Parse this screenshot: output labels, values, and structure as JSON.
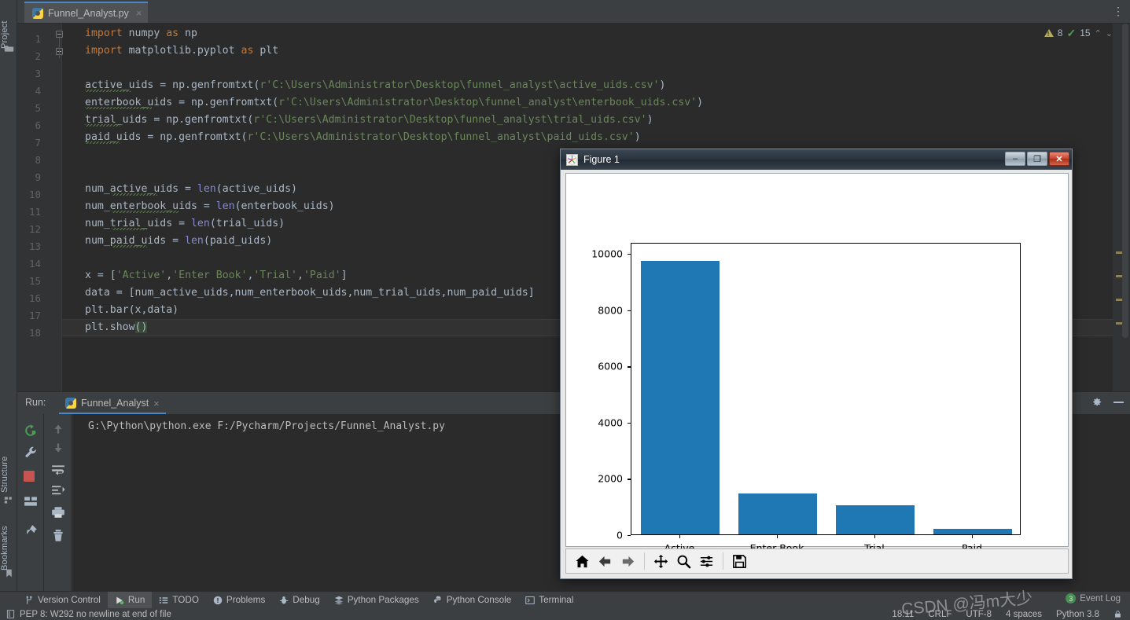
{
  "ide": {
    "left_strip": [
      {
        "label": "Project",
        "icon": "folder-icon"
      },
      {
        "label": "Structure",
        "icon": "structure-icon"
      },
      {
        "label": "Bookmarks",
        "icon": "bookmark-icon"
      }
    ],
    "tab": {
      "title": "Funnel_Analyst.py",
      "close": "×",
      "icon": "python-file-icon"
    },
    "kebab": "⋮",
    "inspections": {
      "warning_count": "8",
      "ok_count": "15",
      "up": "⌃",
      "down": "⌄"
    },
    "editor_lines": [
      {
        "n": "1",
        "text": "import numpy as np"
      },
      {
        "n": "2",
        "text": "import matplotlib.pyplot as plt"
      },
      {
        "n": "3",
        "text": ""
      },
      {
        "n": "4",
        "text": "active_uids = np.genfromtxt(r'C:\\Users\\Administrator\\Desktop\\funnel_analyst\\active_uids.csv')"
      },
      {
        "n": "5",
        "text": "enterbook_uids = np.genfromtxt(r'C:\\Users\\Administrator\\Desktop\\funnel_analyst\\enterbook_uids.csv')"
      },
      {
        "n": "6",
        "text": "trial_uids = np.genfromtxt(r'C:\\Users\\Administrator\\Desktop\\funnel_analyst\\trial_uids.csv')"
      },
      {
        "n": "7",
        "text": "paid_uids = np.genfromtxt(r'C:\\Users\\Administrator\\Desktop\\funnel_analyst\\paid_uids.csv')"
      },
      {
        "n": "8",
        "text": ""
      },
      {
        "n": "9",
        "text": ""
      },
      {
        "n": "10",
        "text": "num_active_uids = len(active_uids)"
      },
      {
        "n": "11",
        "text": "num_enterbook_uids = len(enterbook_uids)"
      },
      {
        "n": "12",
        "text": "num_trial_uids = len(trial_uids)"
      },
      {
        "n": "13",
        "text": "num_paid_uids = len(paid_uids)"
      },
      {
        "n": "14",
        "text": ""
      },
      {
        "n": "15",
        "text": "x = ['Active','Enter Book','Trial','Paid']"
      },
      {
        "n": "16",
        "text": "data = [num_active_uids,num_enterbook_uids,num_trial_uids,num_paid_uids]"
      },
      {
        "n": "17",
        "text": "plt.bar(x,data)"
      },
      {
        "n": "18",
        "text": "plt.show()"
      }
    ],
    "run": {
      "label": "Run:",
      "tab_title": "Funnel_Analyst",
      "tab_close": "×",
      "console_text": "G:\\Python\\python.exe F:/Pycharm/Projects/Funnel_Analyst.py",
      "header_icons": [
        "settings-gear-icon",
        "minimize-icon"
      ],
      "gutter_col1": [
        "rerun-icon",
        "wrench-icon",
        "stop-icon",
        "layout-icon",
        "pin-icon"
      ],
      "gutter_col2": [
        "up-arrow-icon",
        "down-arrow-icon",
        "soft-wrap-icon",
        "scroll-to-end-icon",
        "print-icon",
        "trash-icon"
      ]
    },
    "bottom_tabs": [
      {
        "label": "Version Control",
        "icon": "branch-icon",
        "active": false
      },
      {
        "label": "Run",
        "icon": "play-icon",
        "active": true
      },
      {
        "label": "TODO",
        "icon": "list-icon",
        "active": false
      },
      {
        "label": "Problems",
        "icon": "exclamation-icon",
        "active": false
      },
      {
        "label": "Debug",
        "icon": "bug-icon",
        "active": false
      },
      {
        "label": "Python Packages",
        "icon": "packages-icon",
        "active": false
      },
      {
        "label": "Python Console",
        "icon": "python-icon",
        "active": false
      },
      {
        "label": "Terminal",
        "icon": "terminal-icon",
        "active": false
      }
    ],
    "status_left": "PEP 8: W292 no newline at end of file",
    "status_right": [
      "18:11",
      "CRLF",
      "UTF-8",
      "4 spaces",
      "Python 3.8"
    ],
    "event_log": {
      "label": "Event Log",
      "badge": "3"
    },
    "watermark": "CSDN @冯m大少"
  },
  "figure": {
    "title": "Figure 1",
    "icon": "matplotlib-icon",
    "buttons": {
      "minimize": "–",
      "maximize": "❐",
      "close": "✕"
    },
    "toolbar": [
      {
        "name": "home-icon",
        "glyph": "home"
      },
      {
        "name": "back-arrow-icon",
        "glyph": "back"
      },
      {
        "name": "forward-arrow-icon",
        "glyph": "forward"
      },
      {
        "name": "pan-icon",
        "glyph": "pan"
      },
      {
        "name": "zoom-icon",
        "glyph": "zoom"
      },
      {
        "name": "configure-subplots-icon",
        "glyph": "sliders"
      },
      {
        "name": "save-icon",
        "glyph": "save"
      }
    ]
  },
  "chart_data": {
    "type": "bar",
    "title": "",
    "xlabel": "",
    "ylabel": "",
    "categories": [
      "Active",
      "Enter Book",
      "Trial",
      "Paid"
    ],
    "values": [
      9730,
      1445,
      1030,
      200
    ],
    "ylim": [
      0,
      10400
    ],
    "yticks": [
      0,
      2000,
      4000,
      6000,
      8000,
      10000
    ],
    "ytick_labels": [
      "0",
      "2000",
      "4000",
      "6000",
      "8000",
      "10000"
    ],
    "grid": false,
    "legend": false,
    "bar_color": "#1f77b4",
    "bar_width_ratio": 0.8
  }
}
